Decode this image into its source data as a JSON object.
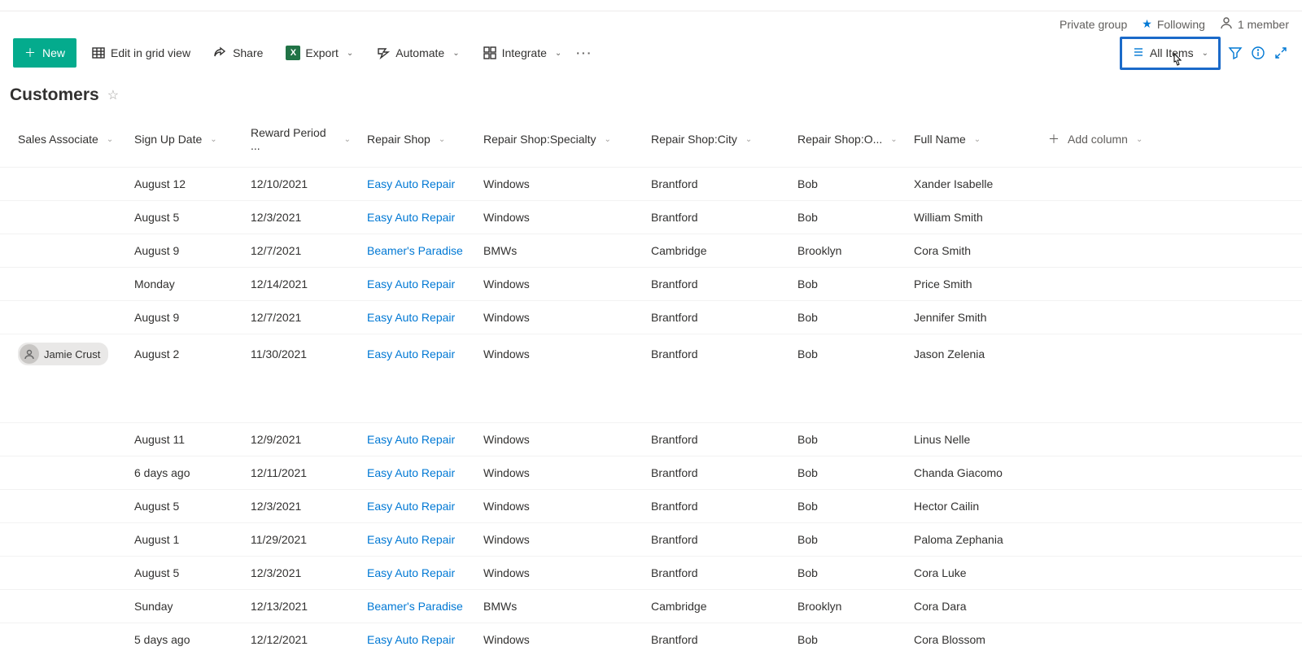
{
  "header": {
    "private_group": "Private group",
    "following": "Following",
    "member_count": "1 member"
  },
  "toolbar": {
    "new_label": "New",
    "edit_grid_label": "Edit in grid view",
    "share_label": "Share",
    "export_label": "Export",
    "automate_label": "Automate",
    "integrate_label": "Integrate",
    "view_label": "All Items"
  },
  "list": {
    "title": "Customers"
  },
  "columns": {
    "sales_associate": "Sales Associate",
    "sign_up_date": "Sign Up Date",
    "reward_period": "Reward Period ...",
    "repair_shop": "Repair Shop",
    "repair_shop_specialty": "Repair Shop:Specialty",
    "repair_shop_city": "Repair Shop:City",
    "repair_shop_owner": "Repair Shop:O...",
    "full_name": "Full Name",
    "add_column": "Add column"
  },
  "rows": [
    {
      "assoc": "",
      "date": "August 12",
      "reward": "12/10/2021",
      "shop": "Easy Auto Repair",
      "spec": "Windows",
      "city": "Brantford",
      "owner": "Bob",
      "name": "Xander Isabelle"
    },
    {
      "assoc": "",
      "date": "August 5",
      "reward": "12/3/2021",
      "shop": "Easy Auto Repair",
      "spec": "Windows",
      "city": "Brantford",
      "owner": "Bob",
      "name": "William Smith"
    },
    {
      "assoc": "",
      "date": "August 9",
      "reward": "12/7/2021",
      "shop": "Beamer's Paradise",
      "spec": "BMWs",
      "city": "Cambridge",
      "owner": "Brooklyn",
      "name": "Cora Smith"
    },
    {
      "assoc": "",
      "date": "Monday",
      "reward": "12/14/2021",
      "shop": "Easy Auto Repair",
      "spec": "Windows",
      "city": "Brantford",
      "owner": "Bob",
      "name": "Price Smith"
    },
    {
      "assoc": "",
      "date": "August 9",
      "reward": "12/7/2021",
      "shop": "Easy Auto Repair",
      "spec": "Windows",
      "city": "Brantford",
      "owner": "Bob",
      "name": "Jennifer Smith"
    },
    {
      "assoc": "Jamie Crust",
      "date": "August 2",
      "reward": "11/30/2021",
      "shop": "Easy Auto Repair",
      "spec": "Windows",
      "city": "Brantford",
      "owner": "Bob",
      "name": "Jason Zelenia"
    }
  ],
  "rows2": [
    {
      "assoc": "",
      "date": "August 11",
      "reward": "12/9/2021",
      "shop": "Easy Auto Repair",
      "spec": "Windows",
      "city": "Brantford",
      "owner": "Bob",
      "name": "Linus Nelle"
    },
    {
      "assoc": "",
      "date": "6 days ago",
      "reward": "12/11/2021",
      "shop": "Easy Auto Repair",
      "spec": "Windows",
      "city": "Brantford",
      "owner": "Bob",
      "name": "Chanda Giacomo"
    },
    {
      "assoc": "",
      "date": "August 5",
      "reward": "12/3/2021",
      "shop": "Easy Auto Repair",
      "spec": "Windows",
      "city": "Brantford",
      "owner": "Bob",
      "name": "Hector Cailin"
    },
    {
      "assoc": "",
      "date": "August 1",
      "reward": "11/29/2021",
      "shop": "Easy Auto Repair",
      "spec": "Windows",
      "city": "Brantford",
      "owner": "Bob",
      "name": "Paloma Zephania"
    },
    {
      "assoc": "",
      "date": "August 5",
      "reward": "12/3/2021",
      "shop": "Easy Auto Repair",
      "spec": "Windows",
      "city": "Brantford",
      "owner": "Bob",
      "name": "Cora Luke"
    },
    {
      "assoc": "",
      "date": "Sunday",
      "reward": "12/13/2021",
      "shop": "Beamer's Paradise",
      "spec": "BMWs",
      "city": "Cambridge",
      "owner": "Brooklyn",
      "name": "Cora Dara"
    },
    {
      "assoc": "",
      "date": "5 days ago",
      "reward": "12/12/2021",
      "shop": "Easy Auto Repair",
      "spec": "Windows",
      "city": "Brantford",
      "owner": "Bob",
      "name": "Cora Blossom"
    }
  ]
}
